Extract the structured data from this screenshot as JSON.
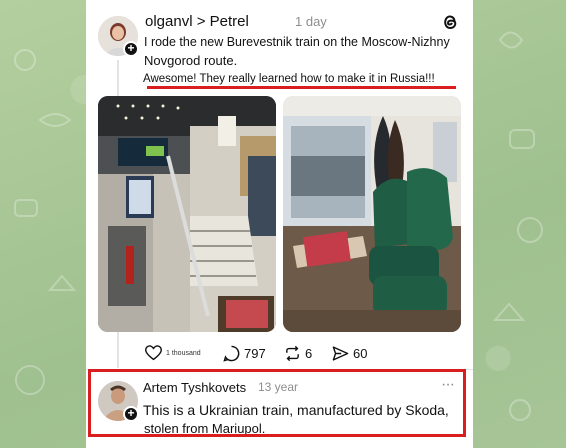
{
  "post": {
    "author": "olganvl > Petrel",
    "time": "1 day",
    "text_line1": "I rode the new Burevestnik train on the Moscow-Nizhny",
    "text_line2": "Novgorod route.",
    "highlight": "Awesome! They really learned how to make it in Russia!!!",
    "icons": [
      "threads-icon",
      "plus-icon"
    ]
  },
  "actions": {
    "likes": "1 thousand",
    "comments": "797",
    "reposts": "6",
    "shares": "60"
  },
  "reply": {
    "author": "Artem Tyshkovets",
    "time": "13 year",
    "text_line1": "This is a Ukrainian train, manufactured by Skoda,",
    "text_line2": "stolen from Mariupol.",
    "menu": "···"
  },
  "colors": {
    "highlight_red": "#d81e1e",
    "seat_green": "#1f5e45",
    "background_green": "#a9c79a"
  }
}
